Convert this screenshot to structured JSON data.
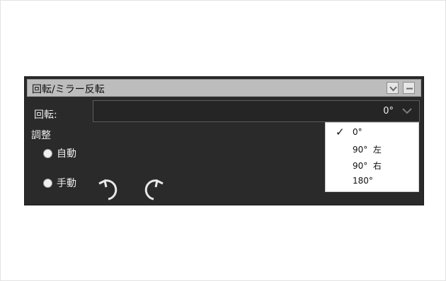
{
  "panel": {
    "title": "回転/ミラー反転"
  },
  "rotation": {
    "label": "回転:",
    "selected_value": "0°",
    "options": [
      {
        "label": "0°",
        "checked": true
      },
      {
        "label": "90°  左",
        "checked": false
      },
      {
        "label": "90°  右",
        "checked": false
      },
      {
        "label": "180°",
        "checked": false
      }
    ],
    "check_mark": "✓"
  },
  "adjust": {
    "label": "調整",
    "auto_label": "自動",
    "manual_label": "手動"
  },
  "icons": {
    "rotate_left": "rotate-ccw-icon",
    "rotate_right": "rotate-cw-icon",
    "panel_menu": "chevron-down-icon",
    "minimize": "minimize-icon"
  },
  "colors": {
    "panel_bg": "#2a2a2a",
    "titlebar_bg": "#bdbdbd",
    "text": "#ececec",
    "dropdown_bg": "#ffffff"
  }
}
